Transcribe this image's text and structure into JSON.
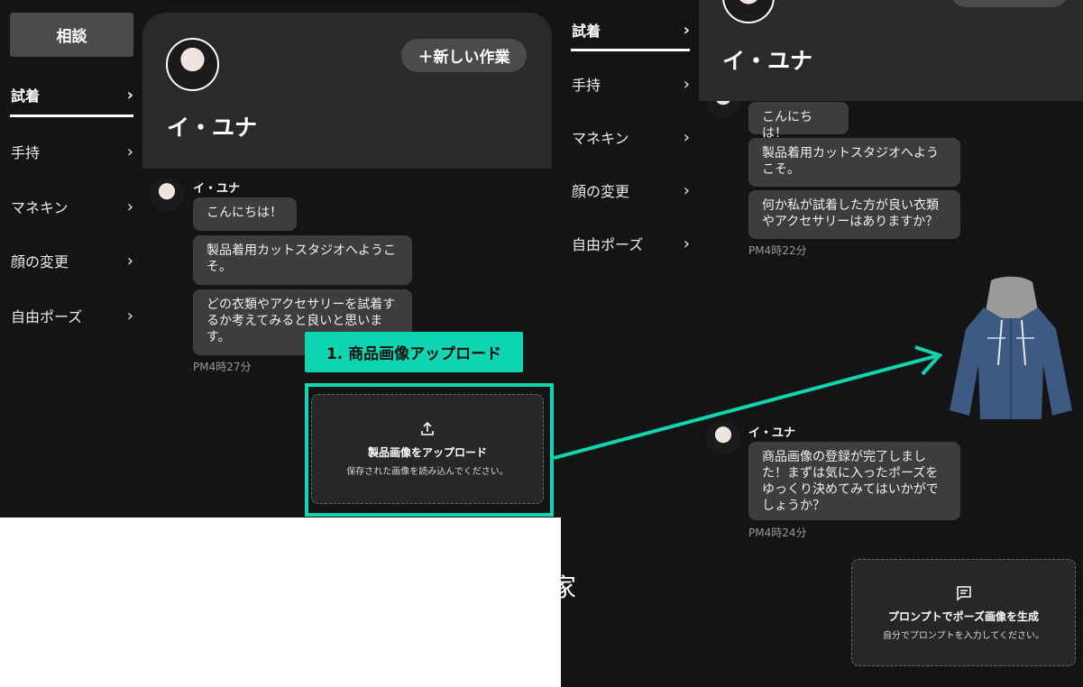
{
  "sidebar": {
    "consult_label": "相談",
    "items": [
      {
        "label": "試着",
        "active": true
      },
      {
        "label": "手持"
      },
      {
        "label": "マネキン"
      },
      {
        "label": "顔の変更"
      },
      {
        "label": "自由ポーズ"
      }
    ]
  },
  "profile": {
    "name": "イ・ユナ",
    "new_work_label": "＋新しい作業"
  },
  "chat_left": {
    "sender": "イ・ユナ",
    "messages": [
      "こんにちは！",
      "製品着用カットスタジオへようこそ。",
      "どの衣類やアクセサリーを試着するか考えてみると良いと思います。"
    ],
    "time": "PM4時27分"
  },
  "callout": {
    "label": "1. 商品画像アップロード",
    "accent": "#0fd6b0"
  },
  "upload": {
    "icon": "upload-icon",
    "title": "製品画像をアップロード",
    "subtitle": "保存された画像を読み込んでください。"
  },
  "clipped_text": "家",
  "right_panel": {
    "name": "イ・ユナ",
    "chat_top": {
      "messages": [
        "こんにちは！",
        "製品着用カットスタジオへようこそ。",
        "何か私が試着した方が良い衣類やアクセサリーはありますか？"
      ],
      "time": "PM4時22分"
    },
    "chat_bottom": {
      "sender": "イ・ユナ",
      "messages": [
        "商品画像の登録が完了しました！まずは気に入ったポーズをゆっくり決めてみてはいかがでしょうか？"
      ],
      "time": "PM4時24分"
    },
    "prompt_box": {
      "icon": "message-icon",
      "title": "プロンプトでポーズ画像を生成",
      "subtitle": "自分でプロンプトを入力してください。"
    }
  }
}
